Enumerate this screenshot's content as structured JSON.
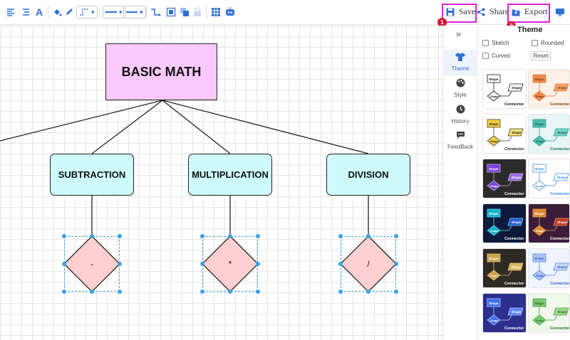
{
  "toolbar": {
    "save_label": "Save",
    "share_label": "Share",
    "export_label": "Export",
    "badge_save": "1",
    "badge_export": "2",
    "highlight_color": "#e020d8",
    "icons": [
      "text-align-icon",
      "font-color-icon",
      "fill-icon",
      "pen-icon",
      "line-style-dropdown",
      "line-weight-dropdown",
      "line-end-dropdown",
      "connector-icon",
      "group-icon",
      "arrange-icon",
      "lock-icon",
      "table-icon",
      "ai-robot-icon"
    ]
  },
  "diagram": {
    "root": "BASIC MATH",
    "children": [
      {
        "label": "SUBTRACTION",
        "symbol": "-"
      },
      {
        "label": "MULTIPLICATION",
        "symbol": "*"
      },
      {
        "label": "DIVISION",
        "symbol": "/"
      }
    ],
    "colors": {
      "root": "#fbc8ff",
      "child": "#cdfbfd",
      "diamond": "#ffd0cf",
      "selection": "#3aa3e6"
    }
  },
  "rail": {
    "items": [
      {
        "label": "Theme",
        "icon": "tshirt-icon"
      },
      {
        "label": "Style",
        "icon": "palette-icon"
      },
      {
        "label": "History",
        "icon": "clock-icon"
      },
      {
        "label": "FeedBack",
        "icon": "feedback-icon"
      }
    ]
  },
  "theme_panel": {
    "title": "Theme",
    "options": {
      "sketch": "Sketch",
      "rounded": "Rounded",
      "curved": "Curved",
      "reset": "Reset"
    },
    "card_text": {
      "shape": "Shape",
      "connector": "Connector"
    },
    "cards": [
      {
        "bg": "#ffffff",
        "a": "#ffffff",
        "b": "#ffffff",
        "stroke": "#111111",
        "text": "#111111"
      },
      {
        "bg": "#fdf1e7",
        "a": "#f08a4b",
        "b": "#f6a26a",
        "stroke": "#e07a3a",
        "text": "#7a3a12"
      },
      {
        "bg": "#ffffff",
        "a": "#f4d03f",
        "b": "#f7dc6f",
        "stroke": "#444444",
        "text": "#222222"
      },
      {
        "bg": "#e7f6f4",
        "a": "#4dbfb0",
        "b": "#76d3c6",
        "stroke": "#2a9d8f",
        "text": "#1d5f57"
      },
      {
        "bg": "#2b2b2b",
        "a": "#7b3fe4",
        "b": "#9b6bf0",
        "stroke": "#bbbbbb",
        "text": "#ffffff"
      },
      {
        "bg": "#ffffff",
        "a": "#ffffff",
        "b": "#ffffff",
        "stroke": "#3a8ee6",
        "text": "#3a8ee6"
      },
      {
        "bg": "#0e1a3a",
        "a": "#12b3c7",
        "b": "#2a5bd7",
        "stroke": "#5fd3e6",
        "text": "#ffffff"
      },
      {
        "bg": "#3b1d3a",
        "a": "#e08a2e",
        "b": "#c0392b",
        "stroke": "#e6a15a",
        "text": "#ffffff"
      },
      {
        "bg": "#2e2a24",
        "a": "#c9a24a",
        "b": "#d8b660",
        "stroke": "#e0c07a",
        "text": "#ffffff"
      },
      {
        "bg": "#eef3fd",
        "a": "#a9c4f5",
        "b": "#c7d8fa",
        "stroke": "#5a86e0",
        "text": "#3a5fb8"
      },
      {
        "bg": "#2c2f8c",
        "a": "#3a6df0",
        "b": "#5b86f5",
        "stroke": "#bcc8ff",
        "text": "#ffffff"
      },
      {
        "bg": "#f0f8ec",
        "a": "#7bc96f",
        "b": "#9bd88f",
        "stroke": "#4a9e3f",
        "text": "#2f6b27"
      }
    ]
  }
}
